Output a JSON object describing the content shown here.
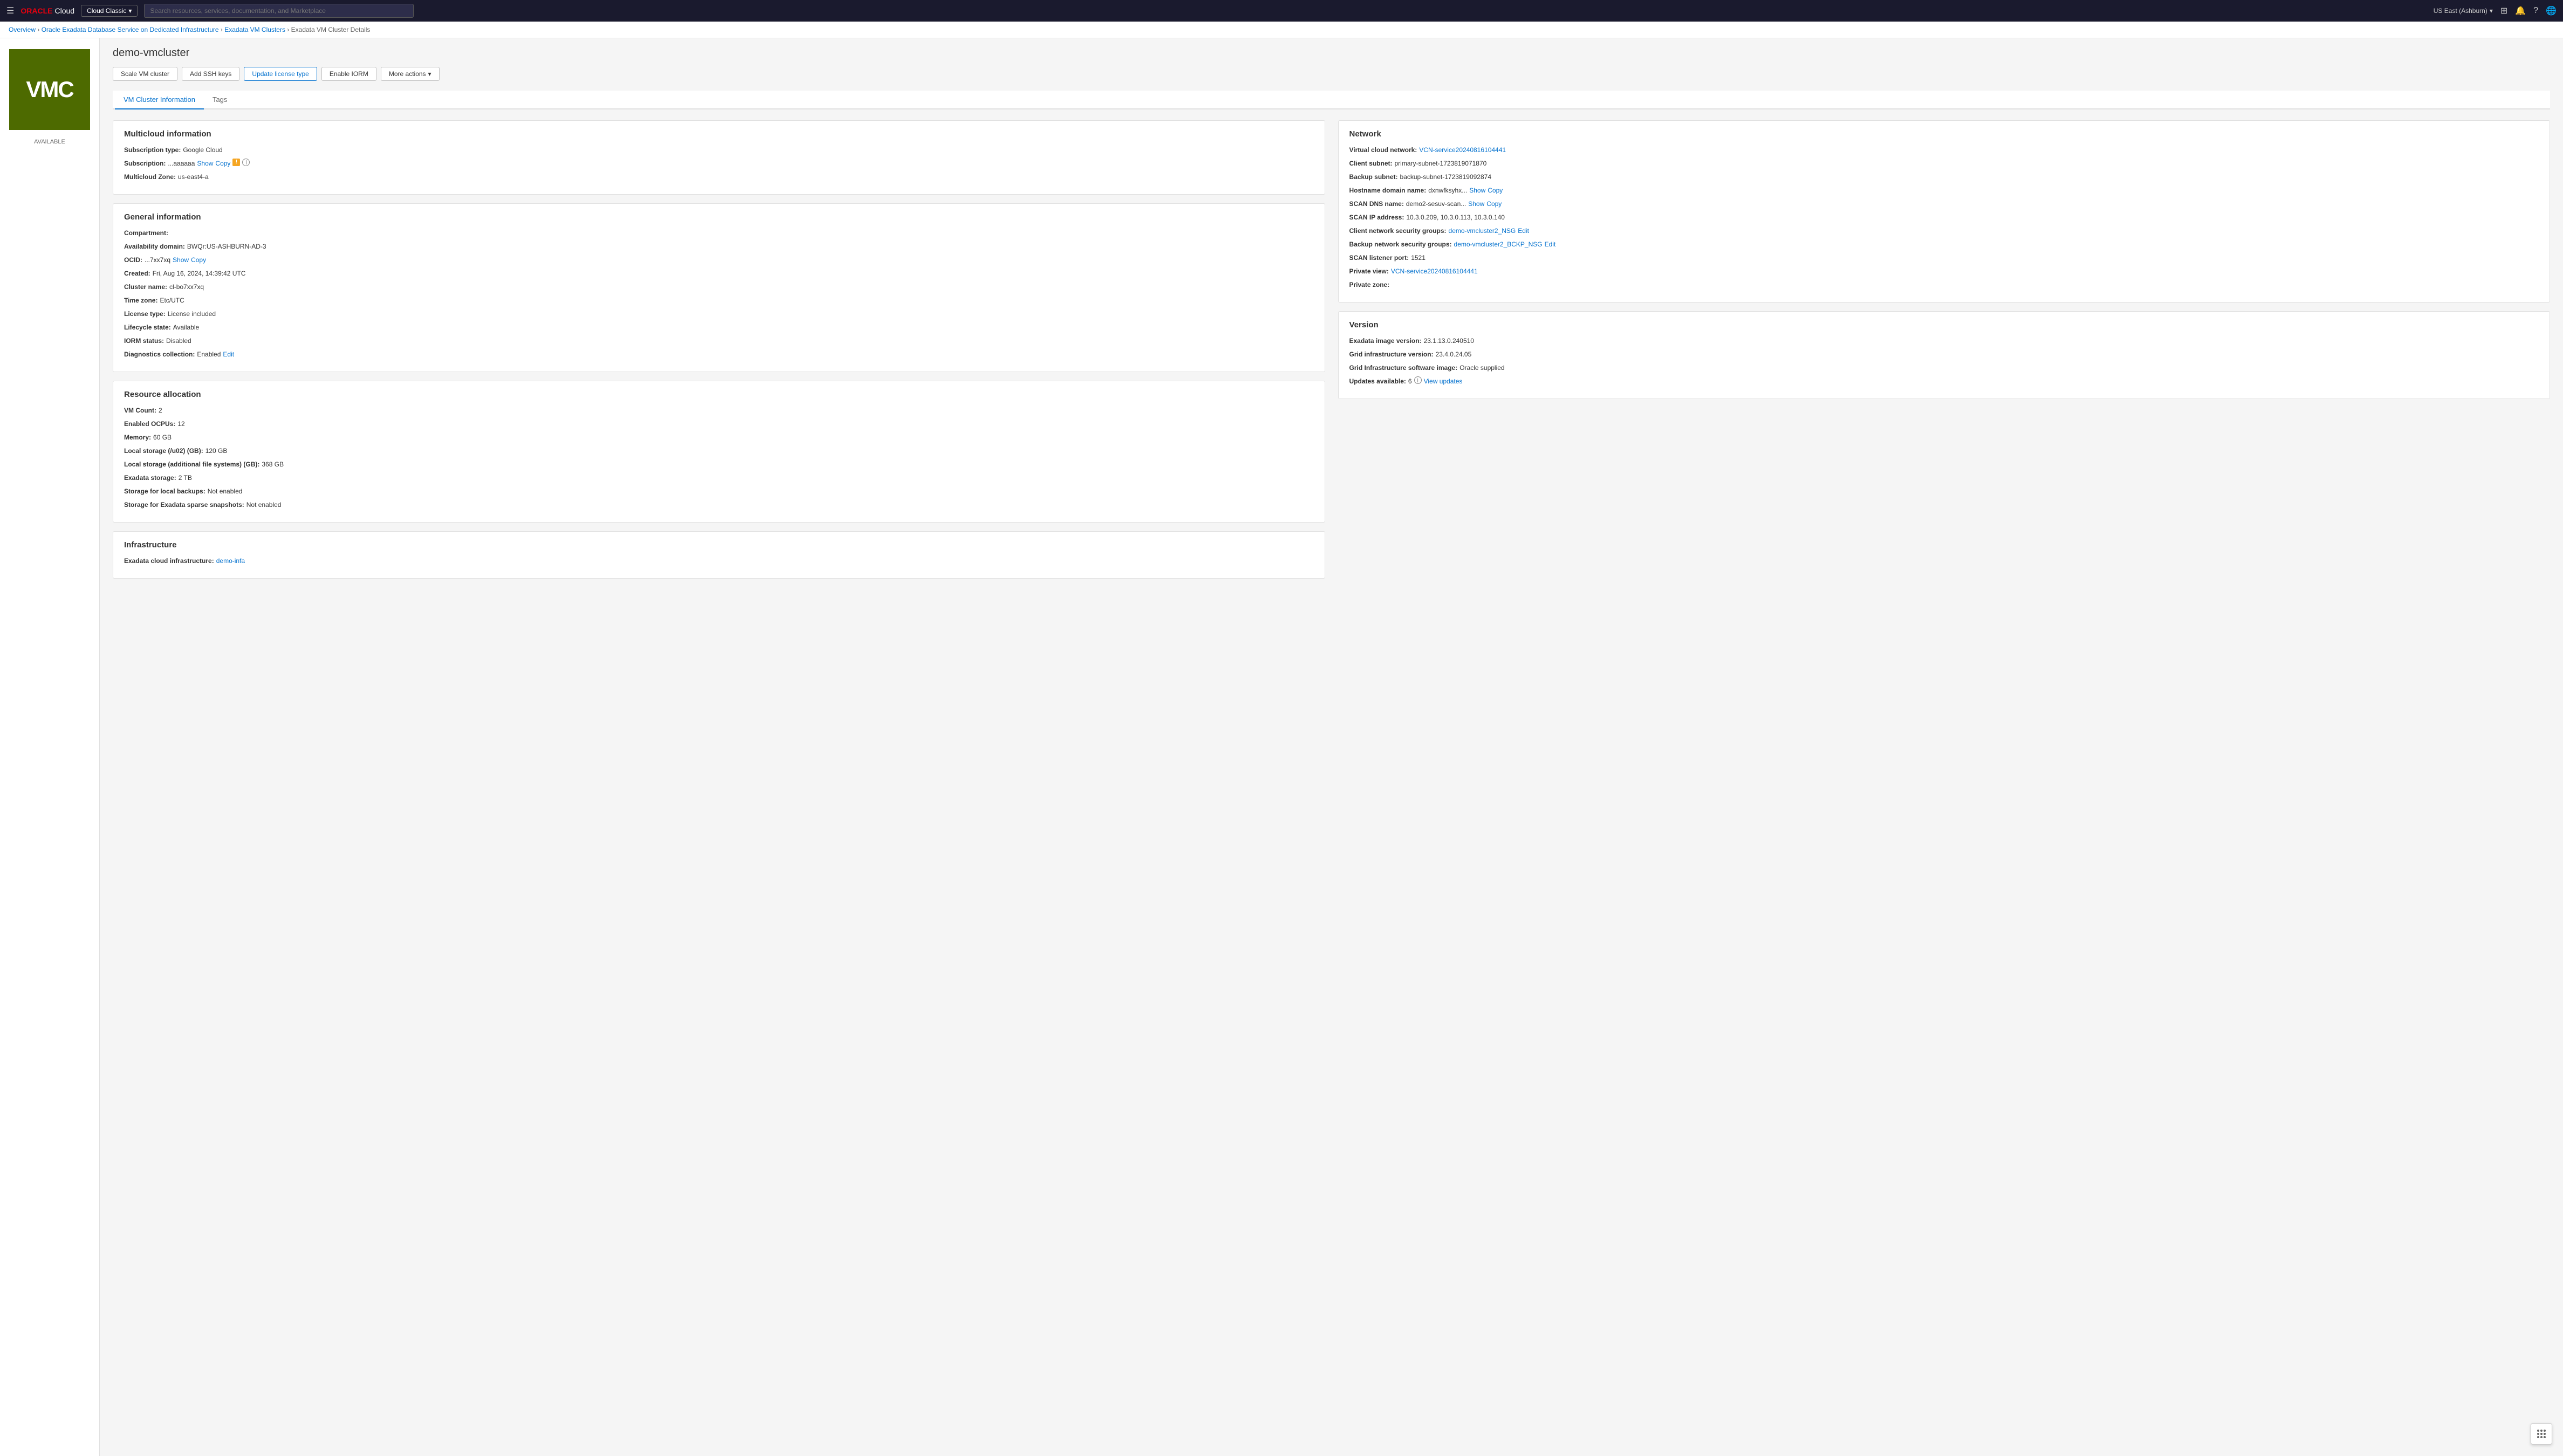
{
  "topnav": {
    "logo_oracle": "ORACLE",
    "logo_cloud": "Cloud",
    "env_btn": "Cloud Classic",
    "search_placeholder": "Search resources, services, documentation, and Marketplace",
    "region": "US East (Ashburn)",
    "hamburger_icon": "☰",
    "chevron_icon": "▾",
    "notifications_icon": "🔔",
    "help_icon": "?",
    "globe_icon": "🌐",
    "profile_icon": "👤"
  },
  "breadcrumb": {
    "items": [
      {
        "label": "Overview",
        "href": "#"
      },
      {
        "label": "Oracle Exadata Database Service on Dedicated Infrastructure",
        "href": "#"
      },
      {
        "label": "Exadata VM Clusters",
        "href": "#"
      },
      {
        "label": "Exadata VM Cluster Details",
        "href": null
      }
    ]
  },
  "sidebar": {
    "icon_text": "VMC",
    "status": "AVAILABLE"
  },
  "page": {
    "title": "demo-vmcluster"
  },
  "buttons": {
    "scale_vm": "Scale VM cluster",
    "add_ssh": "Add SSH keys",
    "update_license": "Update license type",
    "enable_iorm": "Enable IORM",
    "more_actions": "More actions"
  },
  "tabs": [
    {
      "label": "VM Cluster Information",
      "active": true
    },
    {
      "label": "Tags",
      "active": false
    }
  ],
  "multicloud": {
    "section_title": "Multicloud information",
    "subscription_type_label": "Subscription type:",
    "subscription_type_value": "Google Cloud",
    "subscription_label": "Subscription:",
    "subscription_value": "...aaaaaa",
    "subscription_show": "Show",
    "subscription_copy": "Copy",
    "multicloud_zone_label": "Multicloud Zone:",
    "multicloud_zone_value": "us-east4-a"
  },
  "general": {
    "section_title": "General information",
    "compartment_label": "Compartment:",
    "compartment_value": "",
    "availability_domain_label": "Availability domain:",
    "availability_domain_value": "BWQr:US-ASHBURN-AD-3",
    "ocid_label": "OCID:",
    "ocid_value": "...7xx7xq",
    "ocid_show": "Show",
    "ocid_copy": "Copy",
    "created_label": "Created:",
    "created_value": "Fri, Aug 16, 2024, 14:39:42 UTC",
    "cluster_name_label": "Cluster name:",
    "cluster_name_value": "cl-bo7xx7xq",
    "timezone_label": "Time zone:",
    "timezone_value": "Etc/UTC",
    "license_type_label": "License type:",
    "license_type_value": "License included",
    "lifecycle_state_label": "Lifecycle state:",
    "lifecycle_state_value": "Available",
    "iorm_status_label": "IORM status:",
    "iorm_status_value": "Disabled",
    "diagnostics_label": "Diagnostics collection:",
    "diagnostics_value": "Enabled",
    "diagnostics_edit": "Edit"
  },
  "resource_allocation": {
    "section_title": "Resource allocation",
    "vm_count_label": "VM Count:",
    "vm_count_value": "2",
    "enabled_ocpus_label": "Enabled OCPUs:",
    "enabled_ocpus_value": "12",
    "memory_label": "Memory:",
    "memory_value": "60 GB",
    "local_storage_u02_label": "Local storage (/u02) (GB):",
    "local_storage_u02_value": "120 GB",
    "local_storage_add_label": "Local storage (additional file systems) (GB):",
    "local_storage_add_value": "368 GB",
    "exadata_storage_label": "Exadata storage:",
    "exadata_storage_value": "2 TB",
    "storage_backups_label": "Storage for local backups:",
    "storage_backups_value": "Not enabled",
    "storage_snapshots_label": "Storage for Exadata sparse snapshots:",
    "storage_snapshots_value": "Not enabled"
  },
  "infrastructure": {
    "section_title": "Infrastructure",
    "exadata_cloud_label": "Exadata cloud infrastructure:",
    "exadata_cloud_link": "demo-infa",
    "exadata_cloud_href": "#"
  },
  "network": {
    "section_title": "Network",
    "vcn_label": "Virtual cloud network:",
    "vcn_link": "VCN-service20240816104441",
    "vcn_href": "#",
    "client_subnet_label": "Client subnet:",
    "client_subnet_value": "primary-subnet-1723819071870",
    "backup_subnet_label": "Backup subnet:",
    "backup_subnet_value": "backup-subnet-1723819092874",
    "hostname_label": "Hostname domain name:",
    "hostname_value": "dxnwfksyhx...",
    "hostname_show": "Show",
    "hostname_copy": "Copy",
    "scan_dns_label": "SCAN DNS name:",
    "scan_dns_value": "demo2-sesuv-scan...",
    "scan_dns_show": "Show",
    "scan_dns_copy": "Copy",
    "scan_ip_label": "SCAN IP address:",
    "scan_ip_value": "10.3.0.209, 10.3.0.113, 10.3.0.140",
    "client_nsg_label": "Client network security groups:",
    "client_nsg_link": "demo-vmcluster2_NSG",
    "client_nsg_href": "#",
    "client_nsg_edit": "Edit",
    "backup_nsg_label": "Backup network security groups:",
    "backup_nsg_link": "demo-vmcluster2_BCKP_NSG",
    "backup_nsg_href": "#",
    "backup_nsg_edit": "Edit",
    "scan_port_label": "SCAN listener port:",
    "scan_port_value": "1521",
    "private_view_label": "Private view:",
    "private_view_link": "VCN-service20240816104441",
    "private_view_href": "#",
    "private_zone_label": "Private zone:",
    "private_zone_value": ""
  },
  "version": {
    "section_title": "Version",
    "exadata_image_label": "Exadata image version:",
    "exadata_image_value": "23.1.13.0.240510",
    "grid_infra_label": "Grid infrastructure version:",
    "grid_infra_value": "23.4.0.24.05",
    "grid_software_label": "Grid Infrastructure software image:",
    "grid_software_value": "Oracle supplied",
    "updates_label": "Updates available:",
    "updates_count": "6",
    "updates_link": "View updates"
  },
  "fab": {
    "tooltip": "Help"
  }
}
